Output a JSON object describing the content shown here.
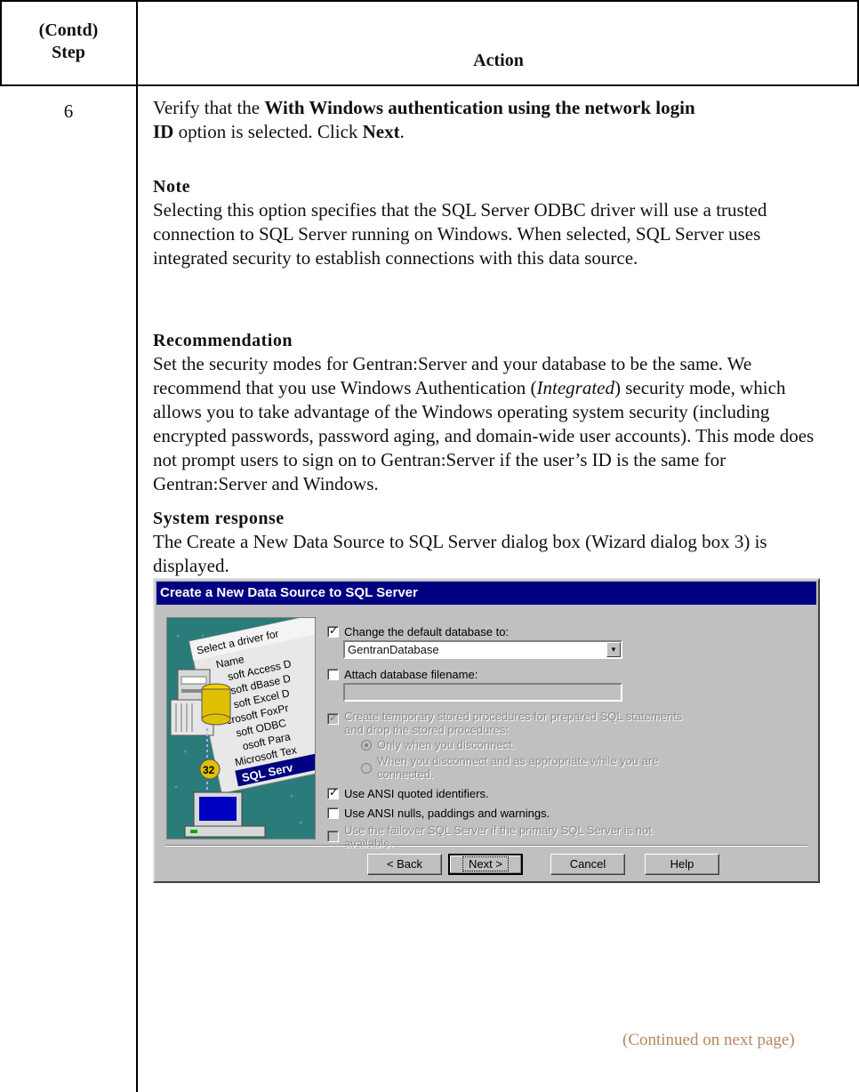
{
  "table": {
    "header_step_line1": "(Contd)",
    "header_step_line2": "Step",
    "header_action": "Action"
  },
  "step": {
    "number": "6",
    "instruction": {
      "pre": "Verify that the ",
      "option_bold_1": "With Windows authentication using the network login",
      "option_bold_2": "ID",
      "mid": " option is selected. Click ",
      "next_bold": "Next",
      "end": "."
    },
    "note": {
      "heading": "Note",
      "text": "Selecting this option specifies that the SQL Server ODBC driver will use a trusted connection to SQL Server running on Windows. When selected, SQL Server uses integrated security to establish connections with this data source."
    },
    "recommendation": {
      "heading": "Recommendation",
      "text_pre": "Set the security modes for Gentran:Server and your database to be the same. We recommend that you use Windows Authentication (",
      "text_italic": "Integrated",
      "text_post": ") security mode, which allows you to take advantage of the Windows operating system security (including encrypted passwords, password aging, and domain-wide user accounts). This mode does not prompt users to sign on to Gentran:Server if the user’s ID is the same for Gentran:Server and Windows."
    },
    "system_response": {
      "heading": "System response",
      "text": "The Create a New Data Source to SQL Server dialog box (Wizard dialog box 3) is displayed."
    }
  },
  "dialog": {
    "title": "Create a New Data Source to SQL Server",
    "wizard_image_text": [
      "Select a driver for",
      "Name",
      "soft Access D",
      "soft dBase D",
      "soft Excel D",
      "crosoft FoxPr",
      "soft ODBC",
      "osoft Para",
      "Microsoft Tex",
      "SQL Serv"
    ],
    "change_default_db_label": "Change the default database to:",
    "database_value": "GentranDatabase",
    "attach_filename_label": "Attach database filename:",
    "attach_filename_value": "",
    "create_temp_label_1": "Create temporary stored procedures for prepared SQL statements",
    "create_temp_label_2": "and drop the stored procedures:",
    "radio_only_disconnect": "Only when you disconnect.",
    "radio_when_disconnect_1": "When you disconnect and as appropriate while you are",
    "radio_when_disconnect_2": "connected.",
    "ansi_quoted_label": "Use ANSI quoted identifiers.",
    "ansi_nulls_label": "Use ANSI nulls, paddings and warnings.",
    "failover_label_1": "Use the failover SQL Server if the primary SQL Server is not",
    "failover_label_2": "available.",
    "checkbox_states": {
      "change_default_db": true,
      "attach_filename": false,
      "create_temp": true,
      "ansi_quoted": true,
      "ansi_nulls": false,
      "failover": false
    },
    "buttons": {
      "back": "< Back",
      "next": "Next >",
      "cancel": "Cancel",
      "help": "Help"
    }
  },
  "footer": {
    "continued": "(Continued on next page)"
  },
  "colors": {
    "title_bar": "#000080",
    "dialog_face": "#c0c0c0",
    "continued_text": "#b5875c"
  }
}
